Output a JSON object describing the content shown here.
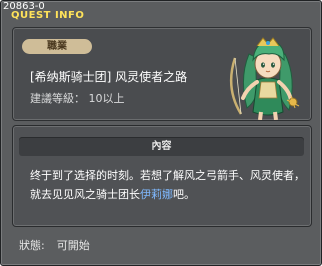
{
  "window": {
    "quest_id": "20863-0",
    "title": "QUEST INFO"
  },
  "quest": {
    "category": "職業",
    "name": "[希纳斯骑士团] 风灵使者之路",
    "required_level": "建議等級： 10以上"
  },
  "description": {
    "header": "內容",
    "text_part1": "终于到了选择的时刻。若想了解风之弓箭手、风灵使者，就去见见风之骑士团长",
    "npc_name": "伊莉娜",
    "text_part2": "吧。"
  },
  "status": {
    "label": "狀態:",
    "value": "可開始"
  },
  "colors": {
    "window_bg": "#5b5d5f",
    "title_yellow": "#ffe35a",
    "badge_tan": "#cfbd98",
    "npc_link_blue": "#7fb9ff"
  },
  "icons": {
    "npc_portrait": "npc-portrait-icon"
  }
}
